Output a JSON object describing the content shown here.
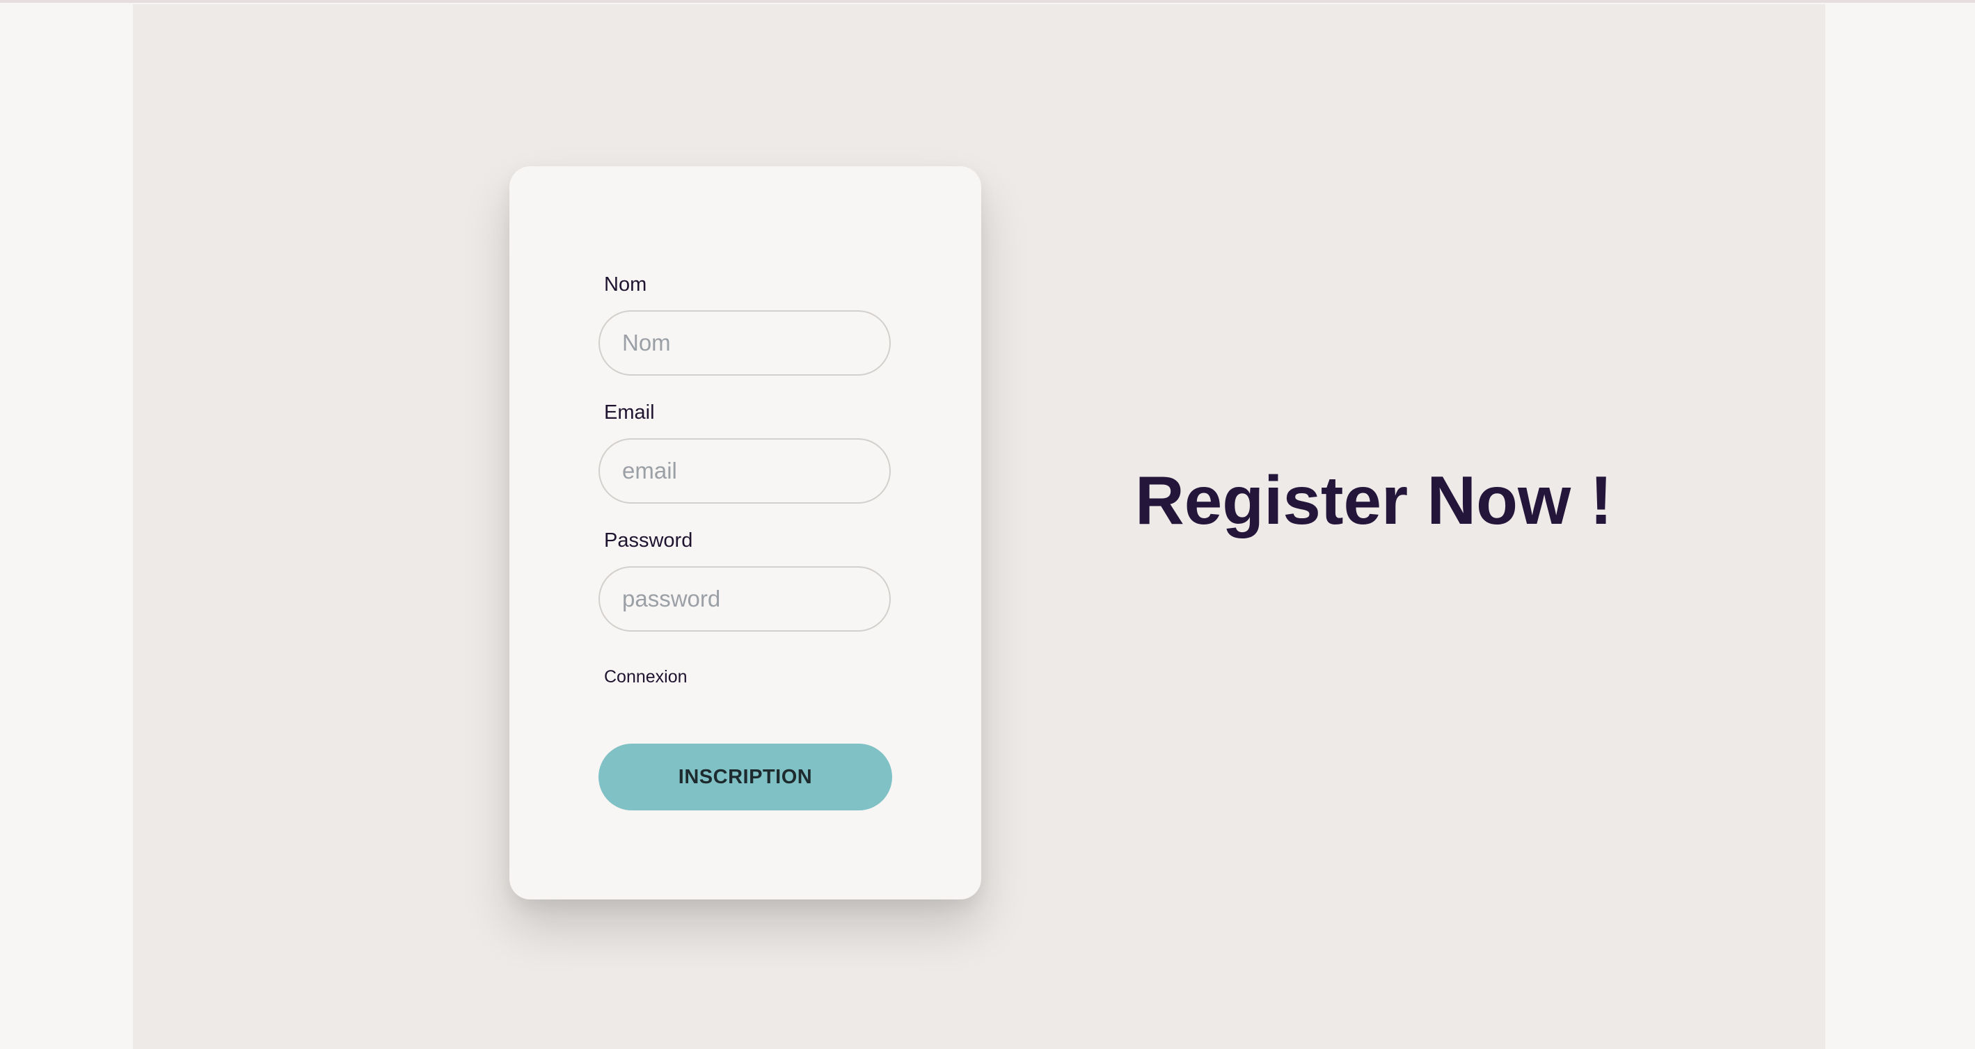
{
  "form": {
    "name_label": "Nom",
    "name_placeholder": "Nom",
    "email_label": "Email",
    "email_placeholder": "email",
    "password_label": "Password",
    "password_placeholder": "password",
    "login_link": "Connexion",
    "submit_label": "INSCRIPTION"
  },
  "hero": {
    "headline": "Register Now !"
  },
  "colors": {
    "page_background": "#f8f6f4",
    "stage_background": "#eeeae7",
    "card_background": "#f8f6f4",
    "accent_button": "#80c1c5",
    "headline_text": "#24163a"
  }
}
